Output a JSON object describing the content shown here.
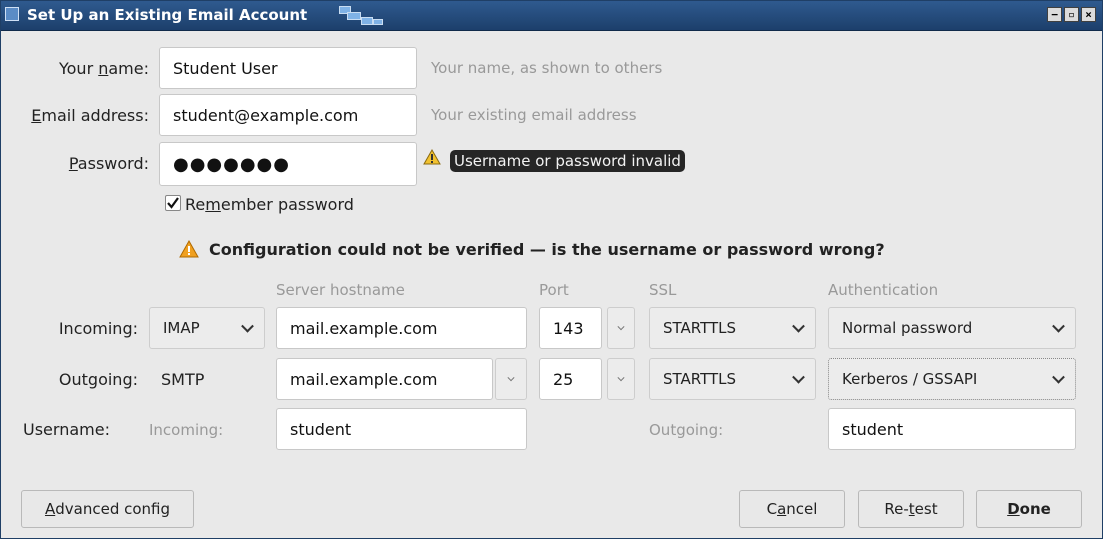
{
  "window": {
    "title": "Set Up an Existing Email Account",
    "controls": [
      "−",
      "▫",
      "×"
    ]
  },
  "form": {
    "name_label": [
      "Your ",
      "n",
      "ame:"
    ],
    "name_value": "Student User",
    "name_hint": "Your name, as shown to others",
    "email_label": [
      "",
      "E",
      "mail address:"
    ],
    "email_value": "student@example.com",
    "email_hint": "Your existing email address",
    "password_label": [
      "",
      "P",
      "assword:"
    ],
    "password_value": "●●●●●●●",
    "password_error": "Username or password invalid",
    "remember_label": [
      "Re",
      "m",
      "ember password"
    ],
    "remember_checked": true
  },
  "status_message": "Configuration could not be verified — is the username or password wrong?",
  "server_table": {
    "columns": [
      "Server hostname",
      "Port",
      "SSL",
      "Authentication"
    ],
    "incoming": {
      "label": "Incoming:",
      "protocol": "IMAP",
      "hostname": "mail.example.com",
      "port": "143",
      "ssl": "STARTTLS",
      "auth": "Normal password"
    },
    "outgoing": {
      "label": "Outgoing:",
      "protocol": "SMTP",
      "hostname": "mail.example.com",
      "port": "25",
      "ssl": "STARTTLS",
      "auth": "Kerberos / GSSAPI"
    },
    "username": {
      "label": "Username:",
      "incoming_label": "Incoming:",
      "incoming_value": "student",
      "outgoing_label": "Outgoing:",
      "outgoing_value": "student"
    }
  },
  "buttons": {
    "advanced": [
      "",
      "A",
      "dvanced config"
    ],
    "cancel": [
      "C",
      "a",
      "ncel"
    ],
    "retest": [
      "Re-",
      "t",
      "est"
    ],
    "done": [
      "",
      "D",
      "one"
    ]
  },
  "colors": {
    "titlebar": "#1c3f6b",
    "warning": "#f0a020",
    "error_tag": "#262626"
  },
  "icons": [
    "warning-icon",
    "checkbox-checked-icon",
    "chevron-down-icon"
  ]
}
